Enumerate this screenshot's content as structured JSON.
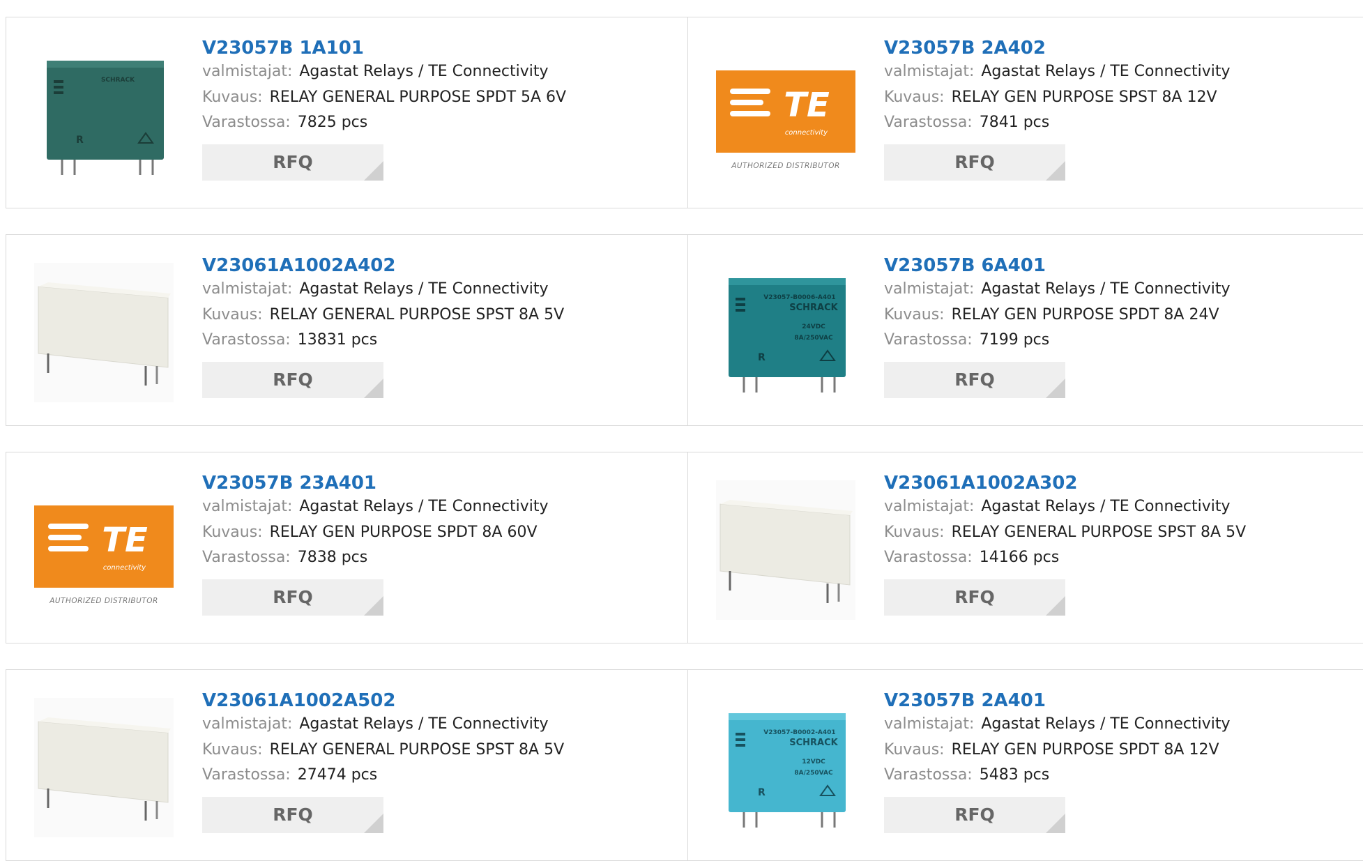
{
  "labels": {
    "manufacturer": "valmistajat:",
    "description": "Kuvaus:",
    "stock": "Varastossa:",
    "rfq": "RFQ"
  },
  "te_logo": {
    "text": "TE",
    "sub": "connectivity",
    "caption": "AUTHORIZED DISTRIBUTOR",
    "color": "#f08a1c"
  },
  "products": [
    {
      "part": "V23057B 1A101",
      "manufacturer": "Agastat Relays / TE Connectivity",
      "description": "RELAY GENERAL PURPOSE SPDT 5A 6V",
      "stock": "7825 pcs",
      "image": "relay-dark-green",
      "relay_text": [
        "SCHRACK"
      ]
    },
    {
      "part": "V23057B 2A402",
      "manufacturer": "Agastat Relays / TE Connectivity",
      "description": "RELAY GEN PURPOSE SPST 8A 12V",
      "stock": "7841 pcs",
      "image": "te-logo"
    },
    {
      "part": "V23061A1002A402",
      "manufacturer": "Agastat Relays / TE Connectivity",
      "description": "RELAY GENERAL PURPOSE SPST 8A 5V",
      "stock": "13831 pcs",
      "image": "relay-white"
    },
    {
      "part": "V23057B 6A401",
      "manufacturer": "Agastat Relays / TE Connectivity",
      "description": "RELAY GEN PURPOSE SPDT 8A 24V",
      "stock": "7199 pcs",
      "image": "relay-teal",
      "relay_text": [
        "V23057-B0006-A401",
        "SCHRACK",
        "24VDC",
        "8A/250VAC"
      ]
    },
    {
      "part": "V23057B 23A401",
      "manufacturer": "Agastat Relays / TE Connectivity",
      "description": "RELAY GEN PURPOSE SPDT 8A 60V",
      "stock": "7838 pcs",
      "image": "te-logo"
    },
    {
      "part": "V23061A1002A302",
      "manufacturer": "Agastat Relays / TE Connectivity",
      "description": "RELAY GENERAL PURPOSE SPST 8A 5V",
      "stock": "14166 pcs",
      "image": "relay-white"
    },
    {
      "part": "V23061A1002A502",
      "manufacturer": "Agastat Relays / TE Connectivity",
      "description": "RELAY GENERAL PURPOSE SPST 8A 5V",
      "stock": "27474 pcs",
      "image": "relay-white"
    },
    {
      "part": "V23057B 2A401",
      "manufacturer": "Agastat Relays / TE Connectivity",
      "description": "RELAY GEN PURPOSE SPDT 8A 12V",
      "stock": "5483 pcs",
      "image": "relay-light-blue",
      "relay_text": [
        "V23057-B0002-A401",
        "SCHRACK",
        "12VDC",
        "8A/250VAC"
      ]
    }
  ]
}
